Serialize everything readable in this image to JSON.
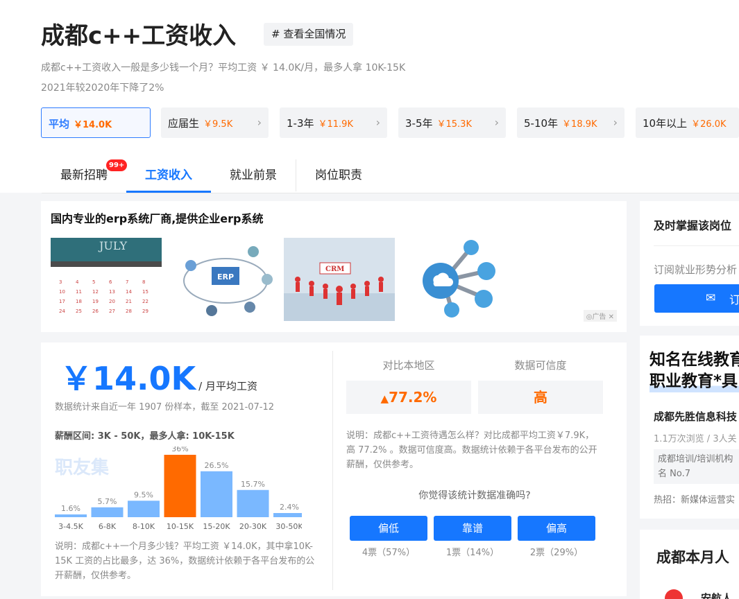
{
  "header": {
    "title": "成都c++工资收入",
    "tag": "# 查看全国情况",
    "summary_line1": "成都c++工资收入一般是多少钱一个月？平均工资 ￥ 14.0K/月，最多人拿 10K-15K",
    "summary_line2": "2021年较2020年下降了2%"
  },
  "experience_tabs": [
    {
      "label": "平均",
      "value": "￥14.0K"
    },
    {
      "label": "应届生",
      "value": "￥9.5K"
    },
    {
      "label": "1-3年",
      "value": "￥11.9K"
    },
    {
      "label": "3-5年",
      "value": "￥15.3K"
    },
    {
      "label": "5-10年",
      "value": "￥18.9K"
    },
    {
      "label": "10年以上",
      "value": "￥26.0K"
    }
  ],
  "nav_tabs": [
    {
      "label": "最新招聘",
      "badge": "99+"
    },
    {
      "label": "工资收入"
    },
    {
      "label": "就业前景"
    },
    {
      "label": "岗位职责"
    }
  ],
  "ad": {
    "title": "国内专业的erp系统厂商,提供企业erp系统",
    "calendar_month": "JULY",
    "erp_text": "ERP",
    "crm_text": "CRM",
    "ad_label": "广告"
  },
  "salary": {
    "amount": "￥14.0K",
    "unit": "/ 月平均工资",
    "stat": "数据统计来自近一年 1907 份样本，截至 2021-07-12",
    "range": "薪酬区间: 3K - 50K，最多人拿:  10K-15K",
    "watermark": "职友集",
    "note": "说明：成都c++一个月多少钱？平均工资 ￥14.0K，其中拿10K-15K 工资的占比最多，达 36%，数据统计依赖于各平台发布的公开薪酬，仅供参考。"
  },
  "chart_data": {
    "type": "bar",
    "categories": [
      "3-4.5K",
      "6-8K",
      "8-10K",
      "10-15K",
      "15-20K",
      "20-30K",
      "30-50K"
    ],
    "values": [
      1.6,
      5.7,
      9.5,
      36,
      26.5,
      15.7,
      2.4
    ],
    "labels": [
      "1.6%",
      "5.7%",
      "9.5%",
      "36%",
      "26.5%",
      "15.7%",
      "2.4%"
    ],
    "highlight_index": 3,
    "colors": {
      "normal": "#7ab8ff",
      "highlight": "#ff6a00"
    }
  },
  "compare": {
    "local_label": "对比本地区",
    "local_value": "77.2%",
    "trust_label": "数据可信度",
    "trust_value": "高",
    "note": "说明：成都c++工资待遇怎么样？对比成都平均工资￥7.9K，高 77.2% 。数据可信度高。数据统计依赖于各平台发布的公开薪酬，仅供参考。",
    "question": "你觉得该统计数据准确吗?",
    "votes": [
      {
        "label": "偏低",
        "count": "4票（57%）"
      },
      {
        "label": "靠谱",
        "count": "1票（14%）"
      },
      {
        "label": "偏高",
        "count": "2票（29%）"
      }
    ]
  },
  "right": {
    "sub_title": "及时掌握该岗位",
    "sub_text": "订阅就业形势分析",
    "sub_btn": "订",
    "ad_title1": "知名在线教育",
    "ad_title2": "职业教育*具",
    "company": "成都先胜信息科技",
    "company_meta": "1.1万次浏览 / 3人关",
    "company_rank1": "成都培训/培训机构",
    "company_rank2": "名 No.7",
    "company_hot": "热招：新媒体运营实",
    "bottom_title": "成都本月人",
    "bottom_item": "安航人"
  },
  "colors": {
    "accent": "#1677ff",
    "orange": "#ff6a00"
  }
}
